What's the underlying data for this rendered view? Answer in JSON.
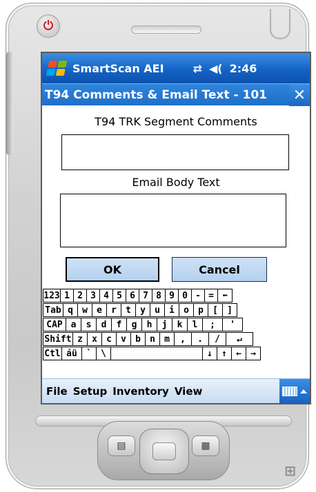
{
  "device": {
    "power_symbol": "⏻",
    "hw_left_symbol": "▤",
    "hw_right_symbol": "▦",
    "windows_logo": "⊞"
  },
  "statusbar": {
    "app_title": "SmartScan AEI",
    "connectivity_symbol": "⇄",
    "volume_symbol": "◀(",
    "time": "2:46",
    "icons": [
      "windows-flag-icon",
      "connectivity-icon",
      "volume-icon"
    ]
  },
  "titlebar": {
    "title": "T94 Comments & Email Text - 101",
    "close_label": "✕"
  },
  "form": {
    "segment_label": "T94 TRK Segment Comments",
    "segment_value": "",
    "email_label": "Email Body Text",
    "email_value": "",
    "ok_label": "OK",
    "cancel_label": "Cancel"
  },
  "keyboard": {
    "rows": [
      [
        "123",
        "1",
        "2",
        "3",
        "4",
        "5",
        "6",
        "7",
        "8",
        "9",
        "0",
        "-",
        "=",
        "⬅"
      ],
      [
        "Tab",
        "q",
        "w",
        "e",
        "r",
        "t",
        "y",
        "u",
        "i",
        "o",
        "p",
        "[",
        "]"
      ],
      [
        "CAP",
        "a",
        "s",
        "d",
        "f",
        "g",
        "h",
        "j",
        "k",
        "l",
        ";",
        "'"
      ],
      [
        "Shift",
        "z",
        "x",
        "c",
        "v",
        "b",
        "n",
        "m",
        ",",
        ".",
        "/",
        "↵"
      ],
      [
        "Ctl",
        "áü",
        "`",
        "\\",
        " ",
        "↓",
        "↑",
        "←",
        "→"
      ]
    ]
  },
  "menubar": {
    "items": [
      "File",
      "Setup",
      "Inventory",
      "View"
    ],
    "sip_icon": "keyboard-icon"
  },
  "colors": {
    "titlebar_blue": "#1e6fc9",
    "button_fill": "#b4d0ef",
    "menubar_bg": "#c7dcf3"
  }
}
